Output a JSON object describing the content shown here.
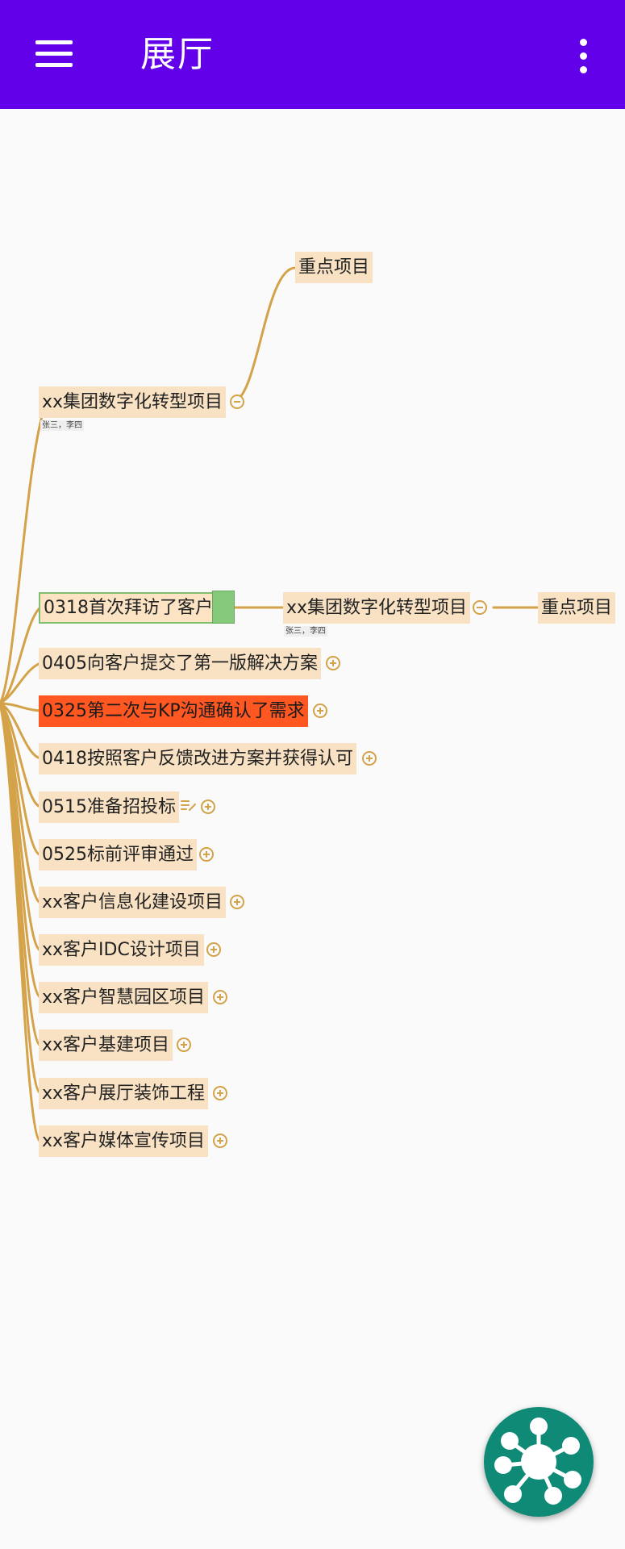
{
  "app_bar": {
    "title": "展厅",
    "background_color": "#6200ea",
    "menu_icon": "hamburger-menu-icon",
    "more_icon": "more-vertical-icon"
  },
  "mindmap": {
    "branch_color": "#d4a248",
    "node_color": "#f9e2c3",
    "highlight_color": "#ff5722",
    "top_branch": {
      "label": "xx集团数字化转型项目",
      "note": "张三，李四",
      "child": "重点项目"
    },
    "selected_branch": {
      "label": "0318首次拜访了客户",
      "child": {
        "label": "xx集团数字化转型项目",
        "note": "张三，李四",
        "child": "重点项目"
      }
    },
    "items": [
      {
        "label": "0405向客户提交了第一版解决方案"
      },
      {
        "label": "0325第二次与KP沟通确认了需求",
        "highlight": true
      },
      {
        "label": "0418按照客户反馈改进方案并获得认可"
      },
      {
        "label": "0515准备招投标",
        "has_note_icon": true
      },
      {
        "label": "0525标前评审通过"
      },
      {
        "label": "xx客户信息化建设项目"
      },
      {
        "label": "xx客户IDC设计项目"
      },
      {
        "label": "xx客户智慧园区项目"
      },
      {
        "label": "xx客户基建项目"
      },
      {
        "label": "xx客户展厅装饰工程"
      },
      {
        "label": "xx客户媒体宣传项目"
      }
    ]
  },
  "fab": {
    "icon": "mind-map-icon",
    "color": "#0f8a77"
  }
}
